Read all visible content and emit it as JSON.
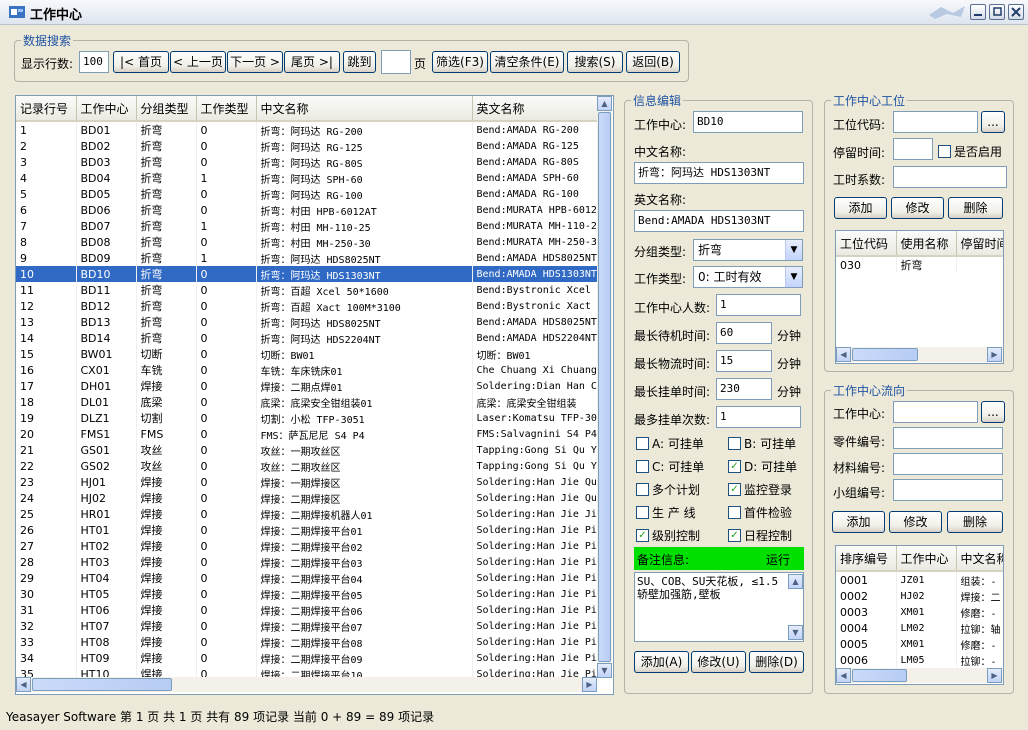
{
  "window": {
    "title": "工作中心"
  },
  "search": {
    "legend": "数据搜索",
    "rows_label": "显示行数:",
    "rows_value": "100",
    "first_btn": "|< 首页",
    "prev_btn": "< 上一页",
    "next_btn": "下一页 >",
    "last_btn": "尾页 >|",
    "jump_btn": "跳到",
    "page_value": "",
    "page_unit": "页",
    "filter_btn": "筛选(F3)",
    "clear_btn": "清空条件(E)",
    "search_btn": "搜索(S)",
    "back_btn": "返回(B)"
  },
  "grid": {
    "columns": [
      "记录行号",
      "工作中心",
      "分组类型",
      "工作类型",
      "中文名称",
      "英文名称"
    ],
    "selected_index": 9,
    "rows": [
      [
        "1",
        "BD01",
        "折弯",
        "0",
        "折弯：阿玛达 RG-200",
        "Bend:AMADA RG-200"
      ],
      [
        "2",
        "BD02",
        "折弯",
        "0",
        "折弯：阿玛达 RG-125",
        "Bend:AMADA RG-125"
      ],
      [
        "3",
        "BD03",
        "折弯",
        "0",
        "折弯：阿玛达 RG-80S",
        "Bend:AMADA RG-80S"
      ],
      [
        "4",
        "BD04",
        "折弯",
        "1",
        "折弯：阿玛达 SPH-60",
        "Bend:AMADA SPH-60"
      ],
      [
        "5",
        "BD05",
        "折弯",
        "0",
        "折弯：阿玛达 RG-100",
        "Bend:AMADA RG-100"
      ],
      [
        "6",
        "BD06",
        "折弯",
        "0",
        "折弯：村田 HPB-6012AT",
        "Bend:MURATA HPB-6012"
      ],
      [
        "7",
        "BD07",
        "折弯",
        "1",
        "折弯：村田 MH-110-25",
        "Bend:MURATA MH-110-2"
      ],
      [
        "8",
        "BD08",
        "折弯",
        "0",
        "折弯：村田 MH-250-30",
        "Bend:MURATA MH-250-3"
      ],
      [
        "9",
        "BD09",
        "折弯",
        "1",
        "折弯：阿玛达 HDS8025NT",
        "Bend:AMADA HDS8025NT"
      ],
      [
        "10",
        "BD10",
        "折弯",
        "0",
        "折弯：阿玛达 HDS1303NT",
        "Bend:AMADA HDS1303NT"
      ],
      [
        "11",
        "BD11",
        "折弯",
        "0",
        "折弯：百超 Xcel 50*1600",
        "Bend:Bystronic Xcel"
      ],
      [
        "12",
        "BD12",
        "折弯",
        "0",
        "折弯：百超 Xact 100M*3100",
        "Bend:Bystronic Xact"
      ],
      [
        "13",
        "BD13",
        "折弯",
        "0",
        "折弯：阿玛达 HDS8025NT",
        "Bend:AMADA HDS8025NT"
      ],
      [
        "14",
        "BD14",
        "折弯",
        "0",
        "折弯：阿玛达 HDS2204NT",
        "Bend:AMADA HDS2204NT"
      ],
      [
        "15",
        "BW01",
        "切断",
        "0",
        "切断：BW01",
        "切断：BW01"
      ],
      [
        "16",
        "CX01",
        "车铣",
        "0",
        "车铣：车床铣床01",
        "Che Chuang Xi Chuang"
      ],
      [
        "17",
        "DH01",
        "焊接",
        "0",
        "焊接：二期点焊01",
        "Soldering:Dian Han C"
      ],
      [
        "18",
        "DL01",
        "底梁",
        "0",
        "底梁：底梁安全钳组装01",
        "底梁：底梁安全钳组装"
      ],
      [
        "19",
        "DLZ1",
        "切割",
        "0",
        "切割：小松 TFP-3051",
        "Laser:Komatsu TFP-30"
      ],
      [
        "20",
        "FMS1",
        "FMS",
        "0",
        "FMS：萨瓦尼尼 S4 P4",
        "FMS:Salvagnini S4 P4"
      ],
      [
        "21",
        "GS01",
        "攻丝",
        "0",
        "攻丝：一期攻丝区",
        "Tapping:Gong Si Qu Y"
      ],
      [
        "22",
        "GS02",
        "攻丝",
        "0",
        "攻丝：二期攻丝区",
        "Tapping:Gong Si Qu Y"
      ],
      [
        "23",
        "HJ01",
        "焊接",
        "0",
        "焊接：一期焊接区",
        "Soldering:Han Jie Qu"
      ],
      [
        "24",
        "HJ02",
        "焊接",
        "0",
        "焊接：二期焊接区",
        "Soldering:Han Jie Qu"
      ],
      [
        "25",
        "HR01",
        "焊接",
        "0",
        "焊接：二期焊接机器人01",
        "Soldering:Han Jie Ji"
      ],
      [
        "26",
        "HT01",
        "焊接",
        "0",
        "焊接：二期焊接平台01",
        "Soldering:Han Jie Pi"
      ],
      [
        "27",
        "HT02",
        "焊接",
        "0",
        "焊接：二期焊接平台02",
        "Soldering:Han Jie Pi"
      ],
      [
        "28",
        "HT03",
        "焊接",
        "0",
        "焊接：二期焊接平台03",
        "Soldering:Han Jie Pi"
      ],
      [
        "29",
        "HT04",
        "焊接",
        "0",
        "焊接：二期焊接平台04",
        "Soldering:Han Jie Pi"
      ],
      [
        "30",
        "HT05",
        "焊接",
        "0",
        "焊接：二期焊接平台05",
        "Soldering:Han Jie Pi"
      ],
      [
        "31",
        "HT06",
        "焊接",
        "0",
        "焊接：二期焊接平台06",
        "Soldering:Han Jie Pi"
      ],
      [
        "32",
        "HT07",
        "焊接",
        "0",
        "焊接：二期焊接平台07",
        "Soldering:Han Jie Pi"
      ],
      [
        "33",
        "HT08",
        "焊接",
        "0",
        "焊接：二期焊接平台08",
        "Soldering:Han Jie Pi"
      ],
      [
        "34",
        "HT09",
        "焊接",
        "0",
        "焊接：二期焊接平台09",
        "Soldering:Han Jie Pi"
      ],
      [
        "35",
        "HT10",
        "焊接",
        "0",
        "焊接：二期焊接平台10",
        "Soldering:Han Jie Pi"
      ]
    ]
  },
  "edit": {
    "legend": "信息编辑",
    "wc_label": "工作中心:",
    "wc_value": "BD10",
    "cn_label": "中文名称:",
    "cn_value": "折弯：阿玛达 HDS1303NT",
    "en_label": "英文名称:",
    "en_value": "Bend:AMADA HDS1303NT",
    "group_label": "分组类型:",
    "group_value": "折弯",
    "worktype_label": "工作类型:",
    "worktype_value": "0: 工时有效",
    "people_label": "工作中心人数:",
    "people_value": "1",
    "max_wait_label": "最长待机时间:",
    "max_wait_value": "60",
    "max_logistics_label": "最长物流时间:",
    "max_logistics_value": "15",
    "max_hang_label": "最长挂单时间:",
    "max_hang_value": "230",
    "unit_minute": "分钟",
    "max_hang_count_label": "最多挂单次数:",
    "max_hang_count_value": "1",
    "checks": [
      {
        "label": "A: 可挂单",
        "checked": false
      },
      {
        "label": "B: 可挂单",
        "checked": false
      },
      {
        "label": "C: 可挂单",
        "checked": false
      },
      {
        "label": "D: 可挂单",
        "checked": true
      },
      {
        "label": "多个计划",
        "checked": false
      },
      {
        "label": "监控登录",
        "checked": true
      },
      {
        "label": "生 产 线",
        "checked": false
      },
      {
        "label": "首件检验",
        "checked": false
      },
      {
        "label": "级别控制",
        "checked": true
      },
      {
        "label": "日程控制",
        "checked": true
      }
    ],
    "remark_label": "备注信息:",
    "run_status": "运行",
    "remark_text": "SU、COB、SU天花板, ≤1.5 轿壁加强筋,壁板",
    "add_btn": "添加(A)",
    "edit_btn": "修改(U)",
    "delete_btn": "删除(D)"
  },
  "station": {
    "legend": "工作中心工位",
    "code_label": "工位代码:",
    "code_value": "",
    "browse": "...",
    "stay_label": "停留时间:",
    "stay_value": "",
    "enable_label": "是否启用",
    "factor_label": "工时系数:",
    "factor_value": "",
    "add_btn": "添加",
    "edit_btn": "修改",
    "delete_btn": "删除",
    "columns": [
      "工位代码",
      "使用名称",
      "停留时间"
    ],
    "rows": [
      [
        "030",
        "折弯",
        ""
      ]
    ]
  },
  "flow": {
    "legend": "工作中心流向",
    "wc_label": "工作中心:",
    "wc_value": "",
    "browse": "...",
    "part_label": "零件编号:",
    "material_label": "材料编号:",
    "team_label": "小组编号:",
    "add_btn": "添加",
    "edit_btn": "修改",
    "delete_btn": "删除",
    "columns": [
      "排序编号",
      "工作中心",
      "中文名称"
    ],
    "rows": [
      [
        "0001",
        "JZ01",
        "组装：-"
      ],
      [
        "0002",
        "HJ02",
        "焊接：二"
      ],
      [
        "0003",
        "XM01",
        "修磨：-"
      ],
      [
        "0004",
        "LM02",
        "拉铆：轴"
      ],
      [
        "0005",
        "XM01",
        "修磨：-"
      ],
      [
        "0006",
        "LM05",
        "拉铆：-"
      ]
    ]
  },
  "status_bar": {
    "text": "Yeasayer Software 第 1 页 共 1 页 共有 89 项记录 当前 0 + 89 = 89 项记录"
  }
}
